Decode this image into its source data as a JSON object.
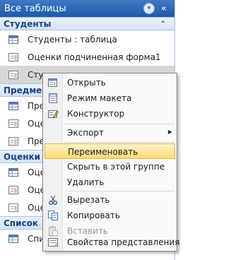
{
  "nav": {
    "title": "Все таблицы",
    "menu_glyph": "▾",
    "collapse_glyph": "«",
    "groups": [
      {
        "name": "Студенты",
        "chevron": "⌃",
        "items": [
          {
            "label": "Студенты : таблица",
            "icon": "table-icon"
          },
          {
            "label": "Оценки подчиненная форма1",
            "icon": "form-icon"
          },
          {
            "label": "Студенты",
            "icon": "form-icon",
            "selected": true
          }
        ]
      },
      {
        "name": "Предме",
        "items": [
          {
            "label": "Пре",
            "icon": "table-icon"
          },
          {
            "label": "Оце",
            "icon": "form-icon"
          },
          {
            "label": "Пре",
            "icon": "form-icon"
          }
        ]
      },
      {
        "name": "Оценки",
        "items": [
          {
            "label": "Оце",
            "icon": "table-icon"
          },
          {
            "label": "Оце",
            "icon": "form-icon"
          },
          {
            "label": "Оце",
            "icon": "form-icon"
          }
        ]
      },
      {
        "name": "Список",
        "items": [
          {
            "label": "Спи",
            "icon": "table-icon"
          }
        ]
      }
    ]
  },
  "context_menu": {
    "items": [
      {
        "label": "Открыть",
        "icon": "open-form-icon"
      },
      {
        "label": "Режим макета",
        "icon": "layout-view-icon"
      },
      {
        "label": "Конструктор",
        "icon": "design-view-icon"
      },
      {
        "label": "Экспорт",
        "submenu_arrow": "▶"
      },
      {
        "label": "Переименовать",
        "highlighted": true
      },
      {
        "label": "Скрыть в этой группе"
      },
      {
        "label": "Удалить"
      },
      {
        "label": "Вырезать",
        "icon": "scissors-icon"
      },
      {
        "label": "Копировать",
        "icon": "copy-icon"
      },
      {
        "label": "Вставить",
        "icon": "paste-icon",
        "disabled": true
      },
      {
        "label": "Свойства представления",
        "icon": "properties-icon"
      }
    ]
  }
}
